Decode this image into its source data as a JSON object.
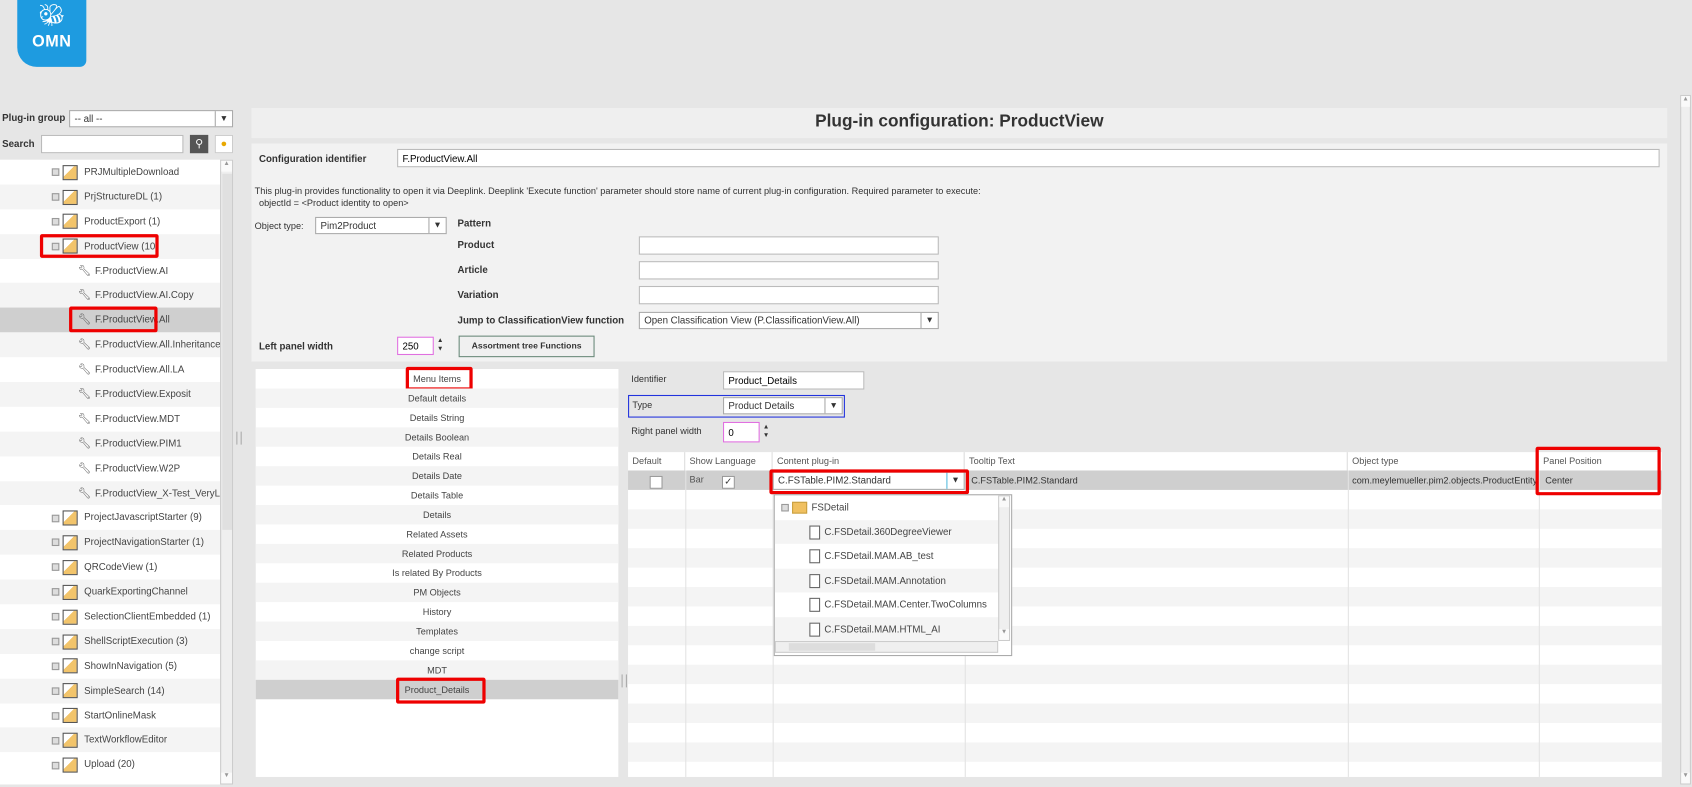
{
  "logo": {
    "text": "OMN"
  },
  "sidebar": {
    "group_label": "Plug-in group",
    "group_value": "-- all --",
    "search_label": "Search",
    "search_value": "",
    "tree": [
      {
        "label": "PRJMultipleDownload",
        "level": 0
      },
      {
        "label": "PrjStructureDL (1)",
        "level": 0
      },
      {
        "label": "ProductExport (1)",
        "level": 0
      },
      {
        "label": "ProductView (10)",
        "level": 0,
        "highlighted": true
      },
      {
        "label": "F.ProductView.AI",
        "level": 1
      },
      {
        "label": "F.ProductView.AI.Copy",
        "level": 1
      },
      {
        "label": "F.ProductView.All",
        "level": 1,
        "selected": true,
        "highlighted": true
      },
      {
        "label": "F.ProductView.All.Inheritance",
        "level": 1
      },
      {
        "label": "F.ProductView.All.LA",
        "level": 1
      },
      {
        "label": "F.ProductView.Exposit",
        "level": 1
      },
      {
        "label": "F.ProductView.MDT",
        "level": 1
      },
      {
        "label": "F.ProductView.PIM1",
        "level": 1
      },
      {
        "label": "F.ProductView.W2P",
        "level": 1
      },
      {
        "label": "F.ProductView_X-Test_VeryLor",
        "level": 1
      },
      {
        "label": "ProjectJavascriptStarter (9)",
        "level": 0
      },
      {
        "label": "ProjectNavigationStarter (1)",
        "level": 0
      },
      {
        "label": "QRCodeView (1)",
        "level": 0
      },
      {
        "label": "QuarkExportingChannel",
        "level": 0
      },
      {
        "label": "SelectionClientEmbedded (1)",
        "level": 0
      },
      {
        "label": "ShellScriptExecution (3)",
        "level": 0
      },
      {
        "label": "ShowInNavigation (5)",
        "level": 0
      },
      {
        "label": "SimpleSearch (14)",
        "level": 0
      },
      {
        "label": "StartOnlineMask",
        "level": 0
      },
      {
        "label": "TextWorkflowEditor",
        "level": 0
      },
      {
        "label": "Upload (20)",
        "level": 0
      }
    ]
  },
  "main": {
    "title": "Plug-in configuration: ProductView",
    "config_id_label": "Configuration identifier",
    "config_id_value": "F.ProductView.All",
    "description": "This plug-in provides functionality to open it via Deeplink. Deeplink 'Execute function' parameter should store name of current plug-in configuration. Required parameter to execute:",
    "description2": "objectId = <Product identity to open>",
    "object_type_label": "Object type:",
    "object_type_value": "Pim2Product",
    "pattern_label": "Pattern",
    "product_label": "Product",
    "product_value": "",
    "article_label": "Article",
    "article_value": "",
    "variation_label": "Variation",
    "variation_value": "",
    "jump_label": "Jump to ClassificationView function",
    "jump_value": "Open Classification View (P.ClassificationView.All)",
    "left_width_label": "Left panel width",
    "left_width_value": "250",
    "assortment_button": "Assortment tree Functions"
  },
  "menu": {
    "header": "Menu Items",
    "items": [
      "Default details",
      "Details String",
      "Details Boolean",
      "Details Real",
      "Details Date",
      "Details Table",
      "Details",
      "Related Assets",
      "Related Products",
      "Is related By Products",
      "PM Objects",
      "History",
      "Templates",
      "change script",
      "MDT",
      "Product_Details"
    ],
    "selected_index": 15
  },
  "detail": {
    "identifier_label": "Identifier",
    "identifier_value": "Product_Details",
    "type_label": "Type",
    "type_value": "Product Details",
    "right_width_label": "Right panel width",
    "right_width_value": "0",
    "columns": [
      "Default",
      "Show Language Bar",
      "Content plug-in",
      "Tooltip Text",
      "Object type",
      "Panel Position"
    ],
    "row": {
      "default": false,
      "show_language_bar": true,
      "content_plugin": "C.FSTable.PIM2.Standard",
      "tooltip": "C.FSTable.PIM2.Standard",
      "object_type": "com.meylemueller.pim2.objects.ProductEntity",
      "panel_position": "Center"
    },
    "dropdown": {
      "folder": "FSDetail",
      "items": [
        "C.FSDetail.360DegreeViewer",
        "C.FSDetail.MAM.AB_test",
        "C.FSDetail.MAM.Annotation",
        "C.FSDetail.MAM.Center.TwoColumns",
        "C.FSDetail.MAM.HTML_AI"
      ]
    }
  }
}
